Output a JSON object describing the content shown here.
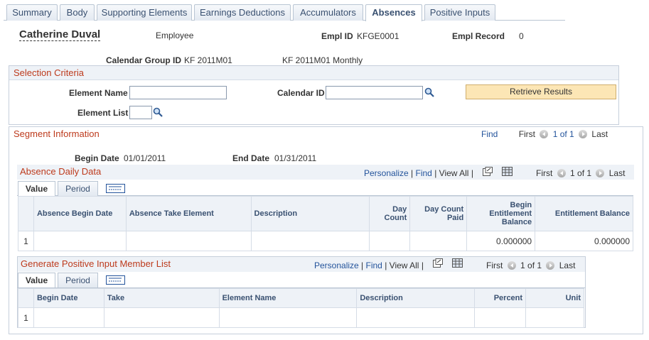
{
  "tabs": [
    {
      "label": "Summary"
    },
    {
      "label": "Body"
    },
    {
      "label": "Supporting Elements"
    },
    {
      "label": "Earnings Deductions"
    },
    {
      "label": "Accumulators"
    },
    {
      "label": "Absences"
    },
    {
      "label": "Positive Inputs"
    }
  ],
  "header": {
    "name": "Catherine Duval",
    "role": "Employee",
    "empl_id_label": "Empl ID",
    "empl_id": "KFGE0001",
    "empl_record_label": "Empl Record",
    "empl_record": "0",
    "calendar_group_label": "Calendar Group ID",
    "calendar_group_id": "KF 2011M01",
    "calendar_group_desc": "KF 2011M01 Monthly"
  },
  "selection": {
    "title": "Selection Criteria",
    "element_name_label": "Element Name",
    "element_name_value": "",
    "calendar_id_label": "Calendar ID",
    "calendar_id_value": "",
    "element_list_label": "Element List",
    "element_list_value": "",
    "retrieve_label": "Retrieve Results"
  },
  "segment": {
    "title": "Segment Information",
    "find": "Find",
    "first": "First",
    "range": "1 of 1",
    "last": "Last",
    "begin_date_label": "Begin Date",
    "begin_date": "01/01/2011",
    "end_date_label": "End Date",
    "end_date": "01/31/2011"
  },
  "absence_grid": {
    "title": "Absence Daily Data",
    "personalize": "Personalize",
    "find": "Find",
    "view_all": "View All",
    "first": "First",
    "range": "1 of 1",
    "last": "Last",
    "tab_value": "Value",
    "tab_period": "Period",
    "columns": [
      "Absence Begin Date",
      "Absence Take Element",
      "Description",
      "Day Count",
      "Day Count Paid",
      "Begin Entitlement Balance",
      "Entitlement Balance"
    ],
    "rows": [
      {
        "num": "1",
        "begin": "",
        "take": "",
        "desc": "",
        "day": "",
        "paid": "",
        "begin_bal": "0.000000",
        "bal": "0.000000"
      }
    ]
  },
  "positive_grid": {
    "title": "Generate Positive Input Member List",
    "personalize": "Personalize",
    "find": "Find",
    "view_all": "View All",
    "first": "First",
    "range": "1 of 1",
    "last": "Last",
    "tab_value": "Value",
    "tab_period": "Period",
    "columns": [
      "Begin Date",
      "Take",
      "Element Name",
      "Description",
      "Percent",
      "Unit"
    ],
    "rows": [
      {
        "num": "1"
      }
    ]
  }
}
